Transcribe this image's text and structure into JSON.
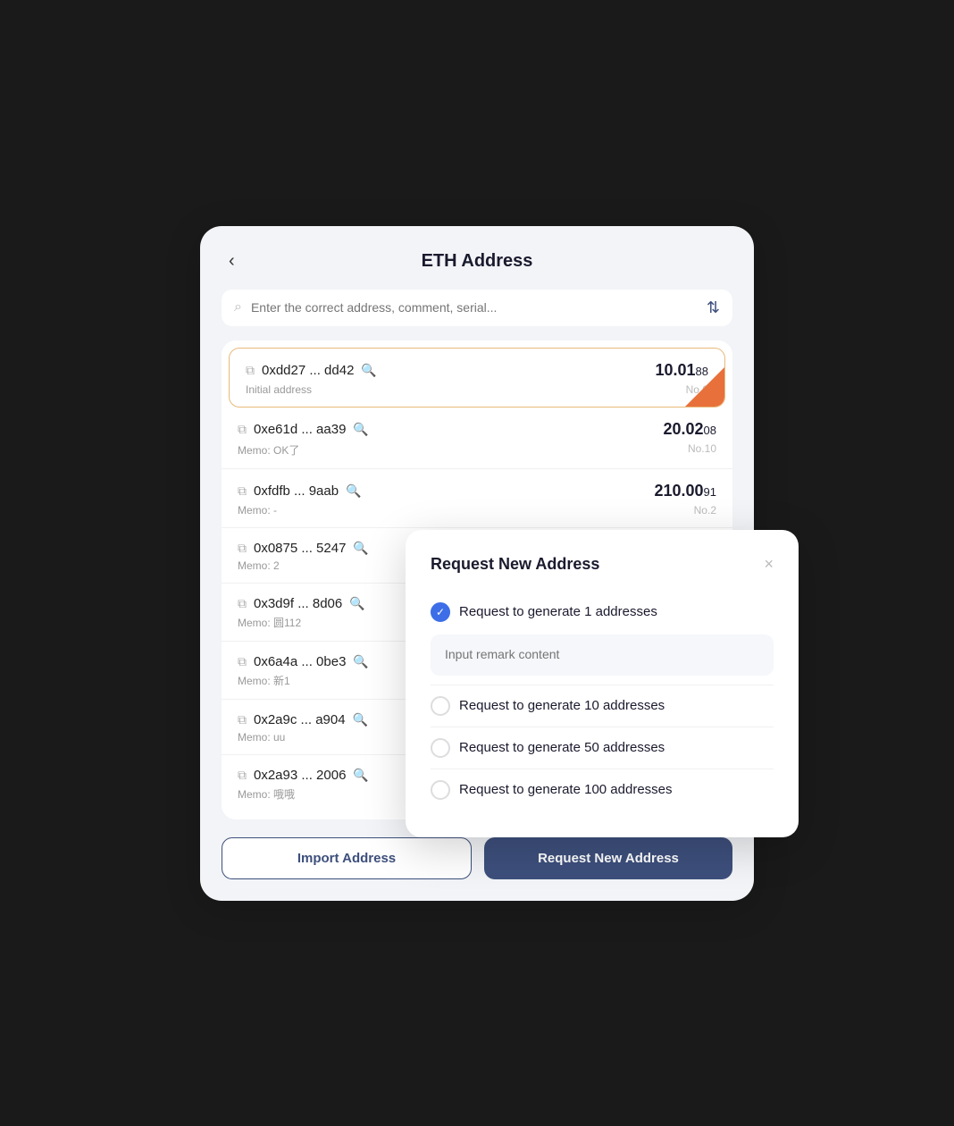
{
  "page": {
    "title": "ETH Address",
    "back_label": "‹"
  },
  "search": {
    "placeholder": "Enter the correct address, comment, serial..."
  },
  "addresses": [
    {
      "id": "addr-1",
      "short": "0xdd27 ... dd42",
      "memo": "Initial address",
      "amount_main": "10.01",
      "amount_decimal": "88",
      "no": "No.0",
      "active": true
    },
    {
      "id": "addr-2",
      "short": "0xe61d ... aa39",
      "memo": "Memo: OK了",
      "amount_main": "20.02",
      "amount_decimal": "08",
      "no": "No.10",
      "active": false
    },
    {
      "id": "addr-3",
      "short": "0xfdfb ... 9aab",
      "memo": "Memo: -",
      "amount_main": "210.00",
      "amount_decimal": "91",
      "no": "No.2",
      "active": false
    },
    {
      "id": "addr-4",
      "short": "0x0875 ... 5247",
      "memo": "Memo: 2",
      "amount_main": "",
      "amount_decimal": "",
      "no": "",
      "active": false
    },
    {
      "id": "addr-5",
      "short": "0x3d9f ... 8d06",
      "memo": "Memo: 圆112",
      "amount_main": "",
      "amount_decimal": "",
      "no": "",
      "active": false
    },
    {
      "id": "addr-6",
      "short": "0x6a4a ... 0be3",
      "memo": "Memo: 新1",
      "amount_main": "",
      "amount_decimal": "",
      "no": "",
      "active": false
    },
    {
      "id": "addr-7",
      "short": "0x2a9c ... a904",
      "memo": "Memo: uu",
      "amount_main": "",
      "amount_decimal": "",
      "no": "",
      "active": false
    },
    {
      "id": "addr-8",
      "short": "0x2a93 ... 2006",
      "memo": "Memo: 哦哦",
      "amount_main": "",
      "amount_decimal": "",
      "no": "",
      "active": false
    }
  ],
  "buttons": {
    "import": "Import Address",
    "request": "Request New Address"
  },
  "modal": {
    "title": "Request New Address",
    "close_icon": "×",
    "remark_placeholder": "Input remark content",
    "options": [
      {
        "label": "Request to generate 1 addresses",
        "checked": true
      },
      {
        "label": "Request to generate 10 addresses",
        "checked": false
      },
      {
        "label": "Request to generate 50 addresses",
        "checked": false
      },
      {
        "label": "Request to generate 100 addresses",
        "checked": false
      }
    ]
  }
}
